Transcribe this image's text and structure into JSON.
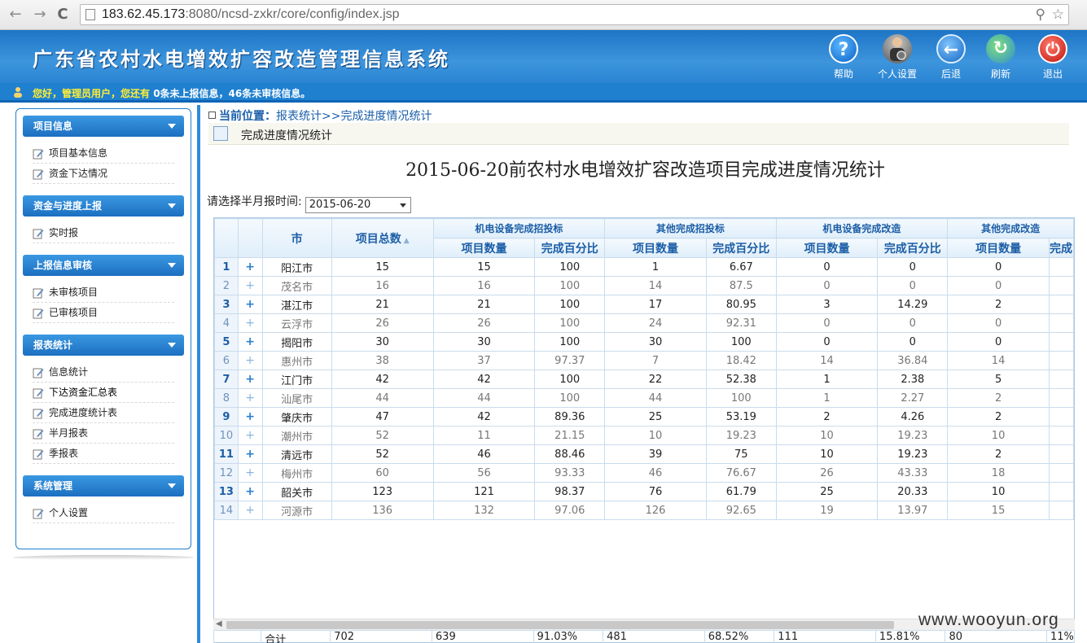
{
  "browser": {
    "back": "←",
    "forward": "→",
    "reload": "C",
    "url_host": "183.62.45.173",
    "url_rest": ":8080/ncsd-zxkr/core/config/index.jsp"
  },
  "header": {
    "title": "广东省农村水电增效扩容改造管理信息系统",
    "tools": [
      {
        "label": "帮助",
        "icon": "help-icon",
        "glyph": "?"
      },
      {
        "label": "个人设置",
        "icon": "user-settings-icon",
        "glyph": "👤"
      },
      {
        "label": "后退",
        "icon": "back-icon",
        "glyph": "←"
      },
      {
        "label": "刷新",
        "icon": "refresh-icon",
        "glyph": "↻"
      },
      {
        "label": "退出",
        "icon": "logout-icon",
        "glyph": "⏻"
      }
    ]
  },
  "notice": {
    "greet": "您好，管理员用户，您还有",
    "rest": "0条未上报信息，46条未审核信息。"
  },
  "sidebar": {
    "groups": [
      {
        "title": "项目信息",
        "items": [
          "项目基本信息",
          "资金下达情况"
        ]
      },
      {
        "title": "资金与进度上报",
        "items": [
          "实时报"
        ]
      },
      {
        "title": "上报信息审核",
        "items": [
          "未审核项目",
          "已审核项目"
        ]
      },
      {
        "title": "报表统计",
        "items": [
          "信息统计",
          "下达资金汇总表",
          "完成进度统计表",
          "半月报表",
          "季报表"
        ]
      },
      {
        "title": "系统管理",
        "items": [
          "个人设置"
        ]
      }
    ]
  },
  "main": {
    "crumb_lead": "当前位置：",
    "crumb_path": "报表统计>>完成进度情况统计",
    "section_title": "完成进度情况统计",
    "report_title": "2015-06-20前农村水电增效扩容改造项目完成进度情况统计",
    "period_label": "请选择半月报时间:",
    "period_value": "2015-06-20"
  },
  "table": {
    "headers": {
      "city": "市",
      "total": "项目总数",
      "groups": [
        "机电设备完成招投标",
        "其他完成招投标",
        "机电设备完成改造",
        "其他完成改造"
      ],
      "sub_count": "项目数量",
      "sub_pct": "完成百分比",
      "sub_pct_partial": "完成"
    },
    "rows": [
      {
        "n": "1",
        "city": "阳江市",
        "total": "15",
        "c1": "15",
        "p1": "100",
        "c2": "1",
        "p2": "6.67",
        "c3": "0",
        "p3": "0",
        "c4": "0"
      },
      {
        "n": "2",
        "city": "茂名市",
        "total": "16",
        "c1": "16",
        "p1": "100",
        "c2": "14",
        "p2": "87.5",
        "c3": "0",
        "p3": "0",
        "c4": "0"
      },
      {
        "n": "3",
        "city": "湛江市",
        "total": "21",
        "c1": "21",
        "p1": "100",
        "c2": "17",
        "p2": "80.95",
        "c3": "3",
        "p3": "14.29",
        "c4": "2"
      },
      {
        "n": "4",
        "city": "云浮市",
        "total": "26",
        "c1": "26",
        "p1": "100",
        "c2": "24",
        "p2": "92.31",
        "c3": "0",
        "p3": "0",
        "c4": "0"
      },
      {
        "n": "5",
        "city": "揭阳市",
        "total": "30",
        "c1": "30",
        "p1": "100",
        "c2": "30",
        "p2": "100",
        "c3": "0",
        "p3": "0",
        "c4": "0"
      },
      {
        "n": "6",
        "city": "惠州市",
        "total": "38",
        "c1": "37",
        "p1": "97.37",
        "c2": "7",
        "p2": "18.42",
        "c3": "14",
        "p3": "36.84",
        "c4": "14"
      },
      {
        "n": "7",
        "city": "江门市",
        "total": "42",
        "c1": "42",
        "p1": "100",
        "c2": "22",
        "p2": "52.38",
        "c3": "1",
        "p3": "2.38",
        "c4": "5"
      },
      {
        "n": "8",
        "city": "汕尾市",
        "total": "44",
        "c1": "44",
        "p1": "100",
        "c2": "44",
        "p2": "100",
        "c3": "1",
        "p3": "2.27",
        "c4": "2"
      },
      {
        "n": "9",
        "city": "肇庆市",
        "total": "47",
        "c1": "42",
        "p1": "89.36",
        "c2": "25",
        "p2": "53.19",
        "c3": "2",
        "p3": "4.26",
        "c4": "2"
      },
      {
        "n": "10",
        "city": "潮州市",
        "total": "52",
        "c1": "11",
        "p1": "21.15",
        "c2": "10",
        "p2": "19.23",
        "c3": "10",
        "p3": "19.23",
        "c4": "10"
      },
      {
        "n": "11",
        "city": "清远市",
        "total": "52",
        "c1": "46",
        "p1": "88.46",
        "c2": "39",
        "p2": "75",
        "c3": "10",
        "p3": "19.23",
        "c4": "2"
      },
      {
        "n": "12",
        "city": "梅州市",
        "total": "60",
        "c1": "56",
        "p1": "93.33",
        "c2": "46",
        "p2": "76.67",
        "c3": "26",
        "p3": "43.33",
        "c4": "18"
      },
      {
        "n": "13",
        "city": "韶关市",
        "total": "123",
        "c1": "121",
        "p1": "98.37",
        "c2": "76",
        "p2": "61.79",
        "c3": "25",
        "p3": "20.33",
        "c4": "10"
      },
      {
        "n": "14",
        "city": "河源市",
        "total": "136",
        "c1": "132",
        "p1": "97.06",
        "c2": "126",
        "p2": "92.65",
        "c3": "19",
        "p3": "13.97",
        "c4": "15"
      }
    ],
    "footer": {
      "label": "合计",
      "total": "702",
      "c1": "639",
      "p1": "91.03%",
      "c2": "481",
      "p2": "68.52%",
      "c3": "111",
      "p3": "15.81%",
      "c4": "80",
      "p4": "11%"
    }
  },
  "watermark": "www.wooyun.org"
}
